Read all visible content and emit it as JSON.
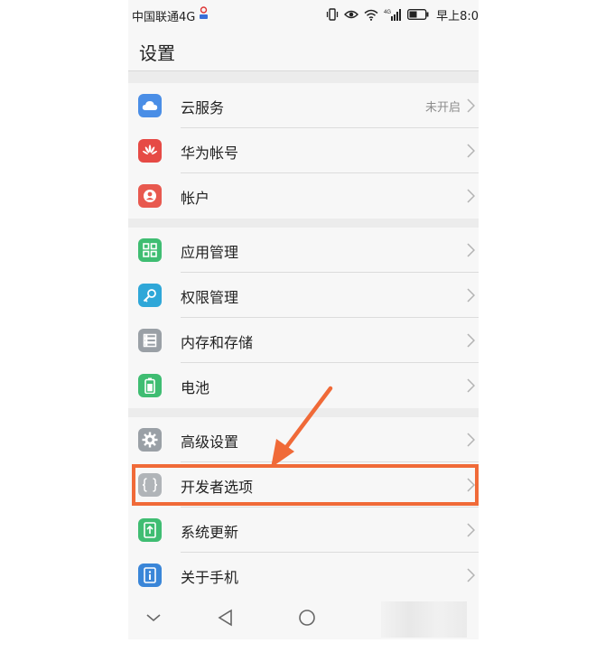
{
  "statusbar": {
    "carrier": "中国联通4G",
    "network_tag": "4G",
    "time": "早上8:0"
  },
  "header": {
    "title": "设置"
  },
  "groups": [
    {
      "items": [
        {
          "label": "云服务",
          "value": "未开启",
          "icon": "cloud-icon",
          "color": "#4a8ee6"
        },
        {
          "label": "华为帐号",
          "icon": "huawei-logo-icon",
          "color": "#e64a45"
        },
        {
          "label": "帐户",
          "icon": "account-icon",
          "color": "#e8594f"
        }
      ]
    },
    {
      "items": [
        {
          "label": "应用管理",
          "icon": "apps-grid-icon",
          "color": "#3fbd72"
        },
        {
          "label": "权限管理",
          "icon": "key-icon",
          "color": "#2fa7d8"
        },
        {
          "label": "内存和存储",
          "icon": "storage-icon",
          "color": "#9aa0a6"
        },
        {
          "label": "电池",
          "icon": "battery-icon",
          "color": "#3fbd72"
        }
      ]
    },
    {
      "items": [
        {
          "label": "高级设置",
          "icon": "gear-icon",
          "color": "#9aa0a6"
        },
        {
          "label": "开发者选项",
          "icon": "braces-icon",
          "color": "#b0b4b8"
        },
        {
          "label": "系统更新",
          "icon": "update-icon",
          "color": "#3fbd72"
        },
        {
          "label": "关于手机",
          "icon": "info-icon",
          "color": "#3a86d8"
        }
      ]
    }
  ],
  "annotation": {
    "color": "#f06a38",
    "highlighted_item": "开发者选项"
  }
}
